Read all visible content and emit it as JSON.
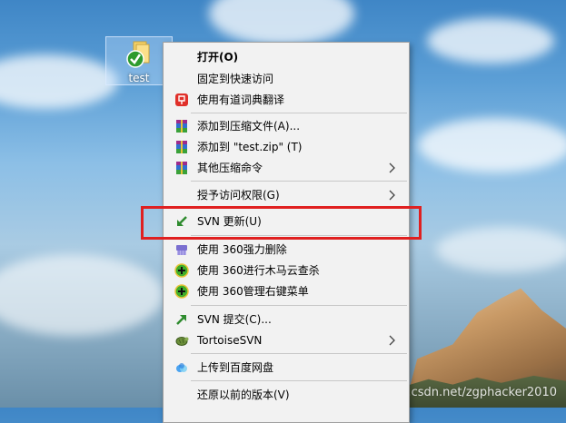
{
  "desktop": {
    "icon_label": "test",
    "watermark": "https://blog.csdn.net/zgphacker2010"
  },
  "context_menu": {
    "items": [
      {
        "label": "打开(O)",
        "icon": "none",
        "bold": true
      },
      {
        "label": "固定到快速访问",
        "icon": "none"
      },
      {
        "label": "使用有道词典翻译",
        "icon": "youdao-dict-icon"
      },
      {
        "label": "添加到压缩文件(A)...",
        "icon": "winrar-archive-icon"
      },
      {
        "label": "添加到 \"test.zip\" (T)",
        "icon": "winrar-archive-icon"
      },
      {
        "label": "其他压缩命令",
        "icon": "winrar-archive-icon",
        "submenu": true
      },
      {
        "label": "授予访问权限(G)",
        "icon": "none",
        "submenu": true
      },
      {
        "label": "SVN 更新(U)",
        "icon": "svn-update-icon"
      },
      {
        "label": "使用 360强力删除",
        "icon": "360-shred-icon"
      },
      {
        "label": "使用 360进行木马云查杀",
        "icon": "360-security-icon"
      },
      {
        "label": "使用 360管理右键菜单",
        "icon": "360-security-icon"
      },
      {
        "label": "SVN 提交(C)...",
        "icon": "svn-commit-icon"
      },
      {
        "label": "TortoiseSVN",
        "icon": "tortoisesvn-icon",
        "submenu": true
      },
      {
        "label": "上传到百度网盘",
        "icon": "baidu-netdisk-icon"
      },
      {
        "label": "还原以前的版本(V)",
        "icon": "none"
      }
    ],
    "highlighted_item": "SVN 更新(U)"
  },
  "colors": {
    "highlight_border": "#e02020",
    "menu_background": "#f2f2f2"
  }
}
